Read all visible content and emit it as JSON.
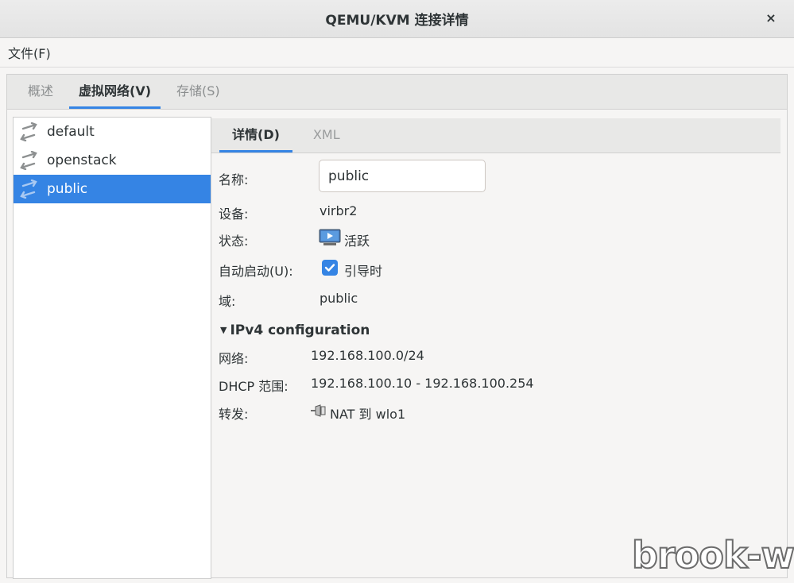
{
  "window": {
    "title": "QEMU/KVM 连接详情",
    "close_label": "×"
  },
  "menubar": {
    "file": "文件(F)"
  },
  "outer_tabs": [
    {
      "label": "概述",
      "active": false
    },
    {
      "label": "虚拟网络(V)",
      "active": true
    },
    {
      "label": "存储(S)",
      "active": false
    }
  ],
  "networks": [
    {
      "name": "default",
      "icon": "network-arrows-icon",
      "selected": false
    },
    {
      "name": "openstack",
      "icon": "network-arrows-icon",
      "selected": false
    },
    {
      "name": "public",
      "icon": "network-arrows-icon",
      "selected": true
    }
  ],
  "inner_tabs": [
    {
      "label": "详情(D)",
      "active": true
    },
    {
      "label": "XML",
      "active": false
    }
  ],
  "details": {
    "name_label": "名称:",
    "name_value": "public",
    "device_label": "设备:",
    "device_value": "virbr2",
    "state_label": "状态:",
    "state_value": "活跃",
    "autostart_label": "自动启动(U):",
    "autostart_value": "引导时",
    "autostart_checked": true,
    "domain_label": "域:",
    "domain_value": "public"
  },
  "ipv4": {
    "heading": "IPv4 configuration",
    "network_label": "网络:",
    "network_value": "192.168.100.0/24",
    "dhcp_label": "DHCP 范围:",
    "dhcp_value": "192.168.100.10 - 192.168.100.254",
    "forward_label": "转发:",
    "forward_value": "NAT 到 wlo1"
  },
  "watermark": "brook-w",
  "colors": {
    "accent": "#3584e4",
    "selected_text": "#ffffff"
  }
}
